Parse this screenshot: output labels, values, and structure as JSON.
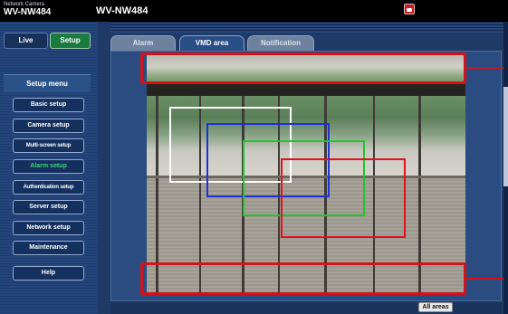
{
  "header": {
    "brand_small": "Network Camera",
    "brand_model": "WV-NW484",
    "title": "WV-NW484",
    "alert_icon": "recording-indicator-icon",
    "alert_color": "#c01f24"
  },
  "sidebar": {
    "tabs": [
      {
        "label": "Live",
        "active": false
      },
      {
        "label": "Setup",
        "active": true
      }
    ],
    "menu_title": "Setup menu",
    "items": [
      {
        "label": "Basic setup",
        "active": false
      },
      {
        "label": "Camera setup",
        "active": false
      },
      {
        "label": "Multi-screen setup",
        "active": false
      },
      {
        "label": "Alarm setup",
        "active": true
      },
      {
        "label": "Authentication setup",
        "active": false
      },
      {
        "label": "Server setup",
        "active": false
      },
      {
        "label": "Network setup",
        "active": false
      },
      {
        "label": "Maintenance",
        "active": false
      }
    ],
    "help_label": "Help",
    "accent_color": "#1a7a3f",
    "active_text_color": "#39d66e"
  },
  "main": {
    "tabs": [
      {
        "label": "Alarm",
        "active": false
      },
      {
        "label": "VMD area",
        "active": true
      },
      {
        "label": "Notification",
        "active": false
      }
    ],
    "detection_areas": [
      {
        "color": "#ffffff"
      },
      {
        "color": "#1d32d6"
      },
      {
        "color": "#22c42c"
      },
      {
        "color": "#e0131b"
      }
    ],
    "callout_color": "#d1121b",
    "all_areas_label": "All areas"
  }
}
